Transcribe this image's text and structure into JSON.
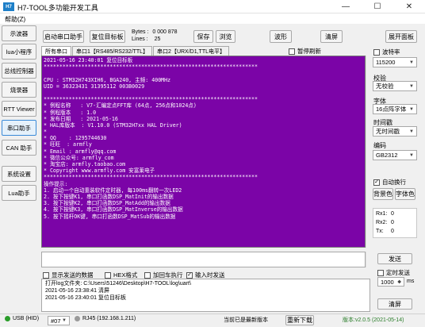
{
  "window": {
    "icon_text": "H7",
    "title": "H7-TOOL多功能开发工具",
    "minimize": "—",
    "maximize": "☐",
    "close": "✕"
  },
  "menu": {
    "help": "帮助(Z)"
  },
  "sidebar": {
    "items": [
      {
        "label": "示波器"
      },
      {
        "label": "lua小程序"
      },
      {
        "label": "总线控制器"
      },
      {
        "label": "烧录器"
      },
      {
        "label": "RTT Viewer"
      },
      {
        "label": "串口助手"
      },
      {
        "label": "CAN 助手"
      },
      {
        "label": "系统设置"
      },
      {
        "label": "Lua助手"
      }
    ]
  },
  "toolbar": {
    "start_assistant": "启动串口助手",
    "reset_target": "复位目标板",
    "bytes_label": "Bytes :",
    "bytes_value": "0 000 878",
    "lines_label": "Lines :",
    "lines_value": "25",
    "save": "保存",
    "browse": "浏览",
    "waveform": "波形",
    "clear_screen": "清屏",
    "expand_panel": "展开面板"
  },
  "tabs": [
    {
      "label": "所有串口"
    },
    {
      "label": "串口1【RS485/RS232/TTL】"
    },
    {
      "label": "串口2【URX/D1,TTL电平】"
    }
  ],
  "pause_refresh": "暂停刷新",
  "console_lines": [
    "2021-05-16 23:40:01 复位目标板",
    "********************************************************************",
    "",
    "CPU : STM32H743XIH6, BGA240, 主频: 400MHz",
    "UID = 36323431 31395112 003B0029",
    "",
    "********************************************************************",
    "* 例程名称   : V7-汇编定点FFT库 (64点, 256点和1024点)",
    "* 例程版本   : 1.0",
    "* 发布日期   : 2021-05-16",
    "* HAL库版本  : V1.10.0 (STM32H7xx HAL Driver)",
    "*",
    "* QQ    : 1295744630",
    "* 旺旺  : armfly",
    "* Email : armfly@qq.com",
    "* 微信公众号: armfly_com",
    "* 淘宝店: armfly.taobao.com",
    "* Copyright www.armfly.com 安富莱电子",
    "********************************************************************",
    "操作提示:",
    "1. 启动一个自动重装软件定时器, 每100ms翻转一次LED2",
    "2. 按下按键K1, 串口打函数DSP_MatInit的输出数据",
    "3. 按下按键K2, 串口打函数DSP_MatAdd的输出数据",
    "4. 按下按键K3, 串口打函数DSP_MatInverse的输出数据",
    "5. 按下摇杆OK键, 串口打函数DSP_MatSub的输出数据"
  ],
  "right_panel": {
    "baud_label": "波特率",
    "baud_value": "115200",
    "parity_label": "校验",
    "parity_value": "无校验",
    "font_label": "字体",
    "font_value": "16点阵字体",
    "timestamp_label": "时间戳",
    "timestamp_value": "无时间戳",
    "encoding_label": "编码",
    "encoding_value": "GB2312",
    "auto_wrap": "自动换行",
    "bg_color": "背景色",
    "font_color": "字体色",
    "rx1_label": "Rx1:",
    "rx1_value": "0",
    "rx2_label": "Rx2:",
    "rx2_value": "0",
    "tx_label": "Tx:",
    "tx_value": "0"
  },
  "send_area": {
    "send_button": "发送",
    "timed_send": "定时发送",
    "interval_value": "1000",
    "interval_unit": "ms",
    "opt_show_sent": "显示发送的数据",
    "opt_hex": "HEX格式",
    "opt_add_cr": "加回车执行",
    "opt_input_send": "输入时发送"
  },
  "log_lines": [
    "打开log文件夹: C:\\Users\\51246\\Desktop\\H7-TOOL\\log\\uart\\",
    "2021-05-16 23:38:41 清屏",
    "2021-05-16 23:40:01 复位目标板"
  ],
  "log_clear": "清屏",
  "statusbar": {
    "usb": "USB (HID)",
    "device": "#07",
    "rj45": "RJ45 (192.168.1.211)",
    "latest": "当前已是最新版本",
    "redownload": "重新下载",
    "version": "版本:v2.0.5 (2021-05-14)"
  },
  "colors": {
    "console_bg": "#7b04a7",
    "console_fg": "#ffffff",
    "status_green": "#2a9d2a",
    "accent_blue": "#1e7fc8"
  }
}
